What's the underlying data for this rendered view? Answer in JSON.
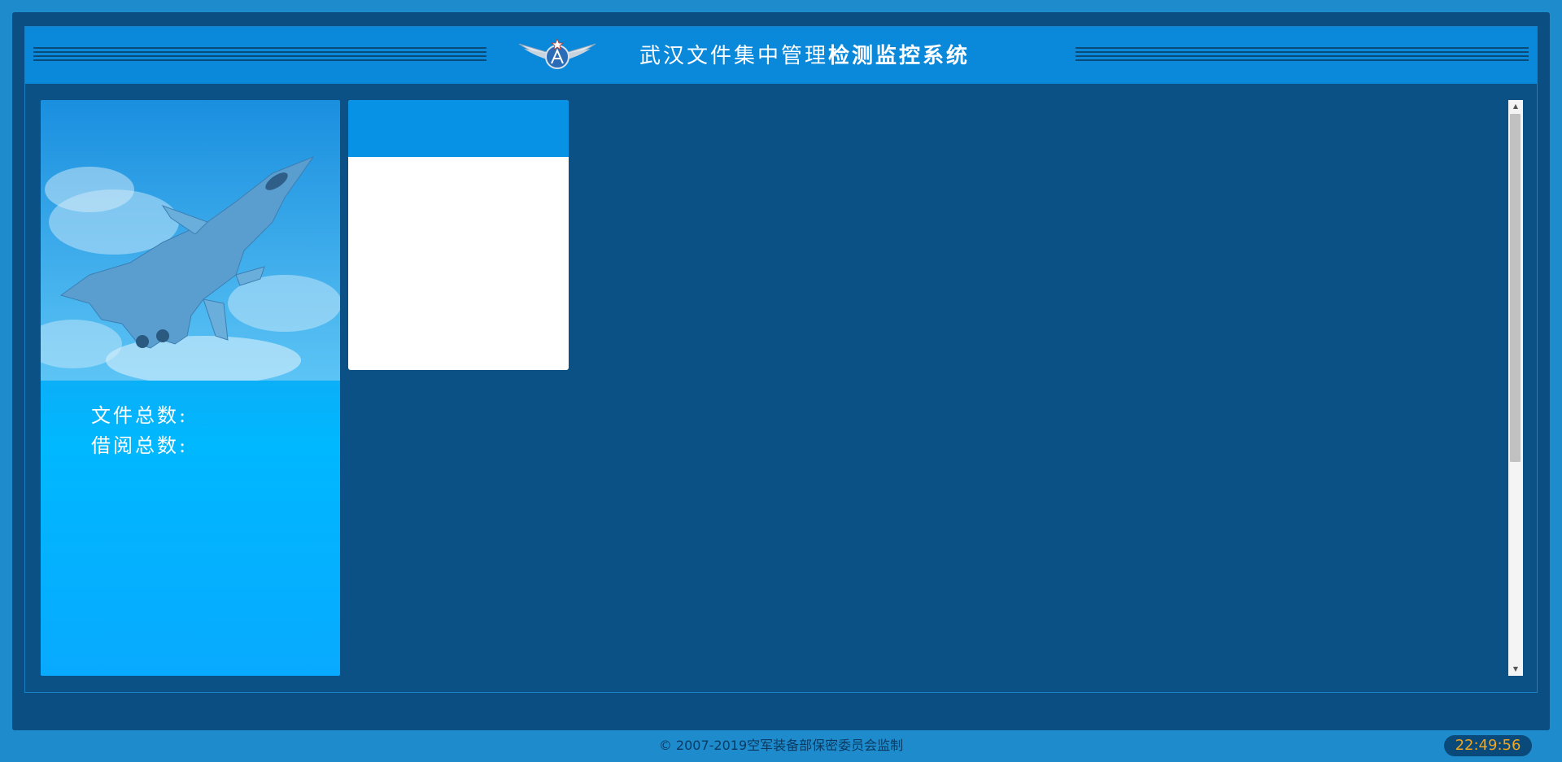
{
  "header": {
    "title_regular": "武汉文件集中管理",
    "title_bold": "检测监控系统",
    "emblem_icon": "air-force-wings-emblem-icon"
  },
  "sidebar": {
    "image_icon": "fighter-jet-in-clouds-image",
    "stats": [
      {
        "label": "文件总数:"
      },
      {
        "label": "借阅总数:"
      }
    ]
  },
  "footer": {
    "copyright": "© 2007-2019空军装备部保密委员会监制",
    "clock": "22:49:56"
  },
  "colors": {
    "page_bg": "#1e8ccc",
    "frame_bg": "#0a4e82",
    "header_bg": "#0a89db",
    "card_header": "#0892e6",
    "clock_text": "#f0a51c"
  }
}
